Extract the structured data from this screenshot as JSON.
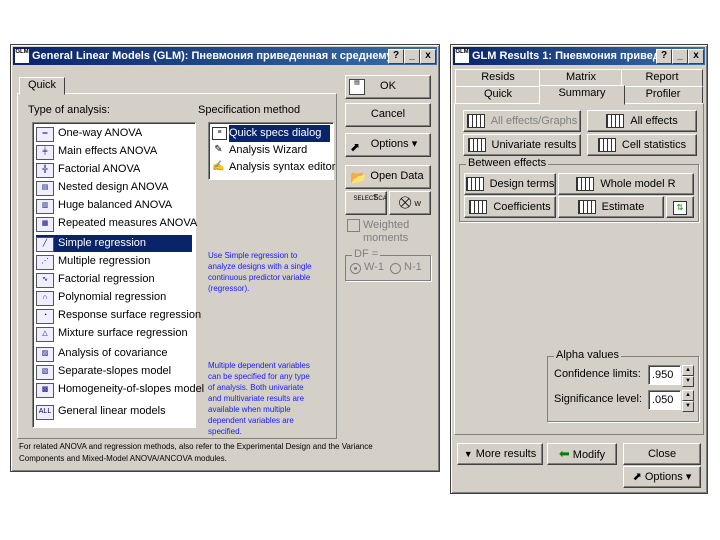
{
  "glm_window": {
    "title": "General Linear Models (GLM): Пневмония приведенная к среднему д",
    "title_icon": "GLM",
    "controls": [
      "?",
      "_",
      "x"
    ],
    "tab_quick": "Quick",
    "type_of_analysis_label": "Type of analysis:",
    "specification_method_label": "Specification method",
    "analysis_types": [
      {
        "label": "One-way ANOVA",
        "icon": "one-way-anova-icon"
      },
      {
        "label": "Main effects ANOVA",
        "icon": "main-effects-icon"
      },
      {
        "label": "Factorial ANOVA",
        "icon": "factorial-icon"
      },
      {
        "label": "Nested design ANOVA",
        "icon": "nested-icon"
      },
      {
        "label": "Huge balanced ANOVA",
        "icon": "huge-balanced-icon"
      },
      {
        "label": "Repeated measures ANOVA",
        "icon": "repeated-measures-icon"
      },
      {
        "label": "Simple regression",
        "icon": "simple-regression-icon",
        "selected": true
      },
      {
        "label": "Multiple regression",
        "icon": "multiple-regression-icon"
      },
      {
        "label": "Factorial regression",
        "icon": "factorial-regression-icon"
      },
      {
        "label": "Polynomial regression",
        "icon": "polynomial-regression-icon"
      },
      {
        "label": "Response surface regression",
        "icon": "response-surface-icon"
      },
      {
        "label": "Mixture surface regression",
        "icon": "mixture-surface-icon"
      },
      {
        "label": "Analysis of covariance",
        "icon": "covariance-icon"
      },
      {
        "label": "Separate-slopes model",
        "icon": "separate-slopes-icon"
      },
      {
        "label": "Homogeneity-of-slopes model",
        "icon": "homogeneity-slopes-icon"
      },
      {
        "label": "General linear models",
        "icon": "general-linear-icon"
      }
    ],
    "spec_methods": [
      {
        "label": "Quick specs dialog",
        "selected": true
      },
      {
        "label": "Analysis Wizard"
      },
      {
        "label": "Analysis syntax editor"
      }
    ],
    "help_text_1": "Use Simple regression to analyze designs with a single continuous predictor variable (regressor).",
    "help_text_2": "Multiple dependent variables can be specified for any type of analysis.  Both univariate and multivariate results are available when multiple dependent variables are specified.",
    "footer_note": "For related ANOVA and regression methods, also refer to the Experimental Design and the Variance Components and Mixed-Model ANOVA/ANCOVA modules.",
    "ok_label": "OK",
    "cancel_label": "Cancel",
    "options_label": "Options",
    "open_data_label": "Open Data",
    "select_cases_label": "SELECT CASES",
    "s_label": "S",
    "w_label": "W",
    "weighted_label": "Weighted moments",
    "df_label": "DF =",
    "df_w1": "W-1",
    "df_n1": "N-1"
  },
  "results_window": {
    "title": "GLM Results 1: Пневмония приведе",
    "title_icon": "GLM",
    "controls": [
      "?",
      "_",
      "x"
    ],
    "tabs_row1": [
      "Resids",
      "Matrix",
      "Report"
    ],
    "tabs_row2": [
      "Quick",
      "Summary",
      "Profiler"
    ],
    "all_effects_graphs": "All effects/Graphs",
    "all_effects": "All effects",
    "univariate_results": "Univariate results",
    "cell_statistics": "Cell statistics",
    "between_effects_label": "Between effects",
    "design_terms": "Design terms",
    "whole_model": "Whole model R",
    "coefficients": "Coefficients",
    "estimate": "Estimate",
    "alpha_values_label": "Alpha values",
    "confidence_limits_label": "Confidence limits:",
    "confidence_value": ".950",
    "significance_level_label": "Significance level:",
    "significance_value": ".050",
    "more_results": "More results",
    "modify": "Modify",
    "close": "Close",
    "options": "Options"
  }
}
